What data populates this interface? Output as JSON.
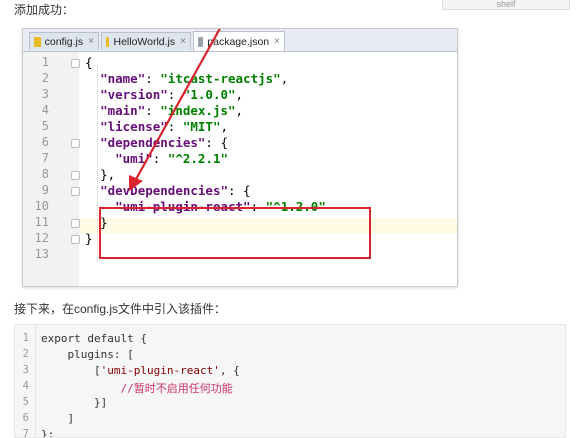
{
  "top_heading": "添加成功：",
  "corner_button": "shelf",
  "editor": {
    "tabs": [
      {
        "label": "config.js",
        "active": false,
        "close": "×"
      },
      {
        "label": "HelloWorld.js",
        "active": false,
        "close": "×"
      },
      {
        "label": "package.json",
        "active": true,
        "close": "×"
      }
    ],
    "line_numbers": [
      "1",
      "2",
      "3",
      "4",
      "5",
      "6",
      "7",
      "8",
      "9",
      "10",
      "11",
      "12",
      "13"
    ],
    "lines": [
      {
        "indent": "",
        "key": "",
        "sep": "{",
        "val": "",
        "end": ""
      },
      {
        "indent": "  ",
        "key": "\"name\"",
        "sep": ": ",
        "val": "\"itcast-reactjs\"",
        "end": ","
      },
      {
        "indent": "  ",
        "key": "\"version\"",
        "sep": ": ",
        "val": "\"1.0.0\"",
        "end": ","
      },
      {
        "indent": "  ",
        "key": "\"main\"",
        "sep": ": ",
        "val": "\"index.js\"",
        "end": ","
      },
      {
        "indent": "  ",
        "key": "\"license\"",
        "sep": ": ",
        "val": "\"MIT\"",
        "end": ","
      },
      {
        "indent": "  ",
        "key": "\"dependencies\"",
        "sep": ": {",
        "val": "",
        "end": ""
      },
      {
        "indent": "    ",
        "key": "\"umi\"",
        "sep": ": ",
        "val": "\"^2.2.1\"",
        "end": ""
      },
      {
        "indent": "  ",
        "key": "",
        "sep": "},",
        "val": "",
        "end": ""
      },
      {
        "indent": "  ",
        "key": "\"devDependencies\"",
        "sep": ": {",
        "val": "",
        "end": ""
      },
      {
        "indent": "    ",
        "key": "\"umi-plugin-react\"",
        "sep": ": ",
        "val": "\"^1.2.0\"",
        "end": ""
      },
      {
        "indent": "  ",
        "key": "",
        "sep": "}",
        "val": "",
        "end": ""
      },
      {
        "indent": "",
        "key": "",
        "sep": "}",
        "val": "",
        "end": ""
      },
      {
        "indent": "",
        "key": "",
        "sep": "",
        "val": "",
        "end": ""
      }
    ]
  },
  "instruction": "接下来，在config.js文件中引入该插件：",
  "code_block": {
    "line_numbers": [
      "1",
      "2",
      "3",
      "4",
      "5",
      "6",
      "7"
    ],
    "lines": [
      {
        "text": "export default {",
        "kind": "plain"
      },
      {
        "text": "    plugins: [",
        "kind": "plain"
      },
      {
        "prefix": "        [",
        "str": "'umi-plugin-react'",
        "suffix": ", {",
        "kind": "str"
      },
      {
        "text": "            //暂时不启用任何功能",
        "kind": "comment"
      },
      {
        "text": "        }]",
        "kind": "plain"
      },
      {
        "text": "    ]",
        "kind": "plain"
      },
      {
        "text": "};",
        "kind": "plain"
      }
    ]
  },
  "colors": {
    "highlight_box": "#d9232e",
    "json_key": "#660e7a",
    "json_string": "#008000",
    "current_line": "#fffae3"
  }
}
